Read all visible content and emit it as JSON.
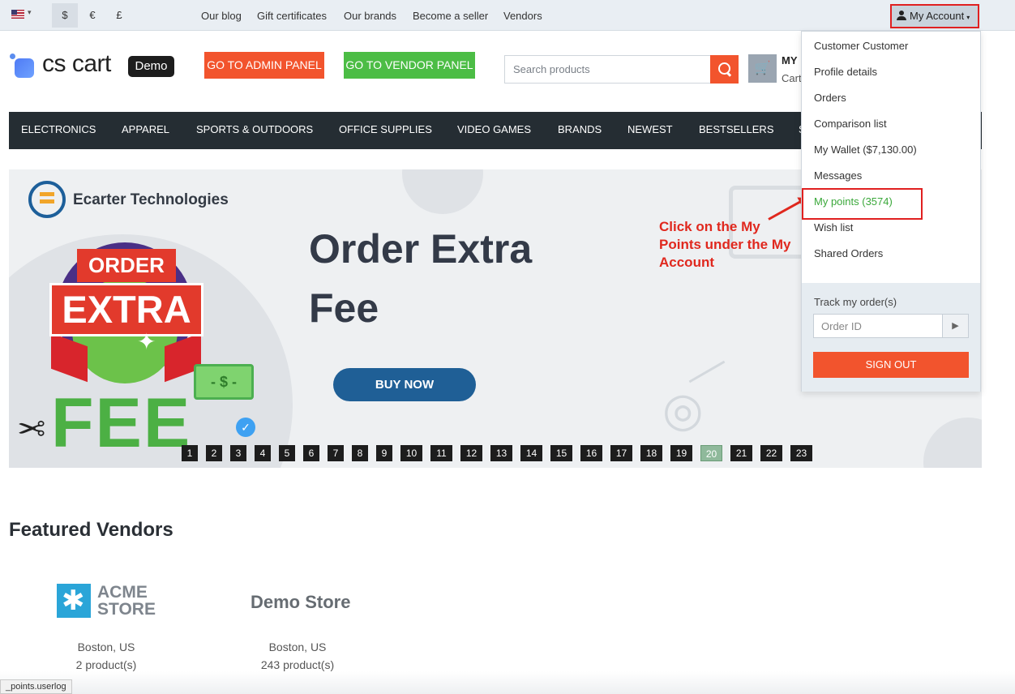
{
  "topbar": {
    "currencies": [
      "$",
      "€",
      "£"
    ],
    "links": [
      "Our blog",
      "Gift certificates",
      "Our brands",
      "Become a seller",
      "Vendors"
    ],
    "account_label": "My Account"
  },
  "header": {
    "logo_text": "cs cart",
    "logo_badge": "Demo",
    "admin_button": "GO TO ADMIN PANEL",
    "vendor_button": "GO TO VENDOR PANEL",
    "search_placeholder": "Search products",
    "cart_title": "MY",
    "cart_sub": "Cart"
  },
  "nav": {
    "items": [
      "ELECTRONICS",
      "APPAREL",
      "SPORTS & OUTDOORS",
      "OFFICE SUPPLIES",
      "VIDEO GAMES",
      "BRANDS",
      "NEWEST",
      "BESTSELLERS",
      "S"
    ]
  },
  "banner": {
    "company": "Ecarter Technologies",
    "badge_order": "ORDER",
    "badge_extra": "EXTRA",
    "badge_fee": "FEE",
    "cash_symbol": "- $ -",
    "headline": "Order Extra Fee",
    "cta": "BUY NOW",
    "annotation_lines": [
      "Click on the My",
      "Points under the My",
      "Account"
    ],
    "pages": [
      "1",
      "2",
      "3",
      "4",
      "5",
      "6",
      "7",
      "8",
      "9",
      "10",
      "11",
      "12",
      "13",
      "14",
      "15",
      "16",
      "17",
      "18",
      "19",
      "20",
      "21",
      "22",
      "23"
    ],
    "active_page": "20"
  },
  "account_menu": {
    "items": [
      "Customer Customer",
      "Profile details",
      "Orders",
      "Comparison list",
      "My Wallet ($7,130.00)",
      "Messages",
      "My points (3574)",
      "Wish list",
      "Shared Orders"
    ],
    "track_label": "Track my order(s)",
    "order_placeholder": "Order ID",
    "sign_out": "SIGN OUT"
  },
  "featured": {
    "title": "Featured Vendors",
    "vendors": [
      {
        "name_line1": "ACME",
        "name_line2": "STORE",
        "location": "Boston, US",
        "products": "2 product(s)"
      },
      {
        "name": "Demo Store",
        "location": "Boston, US",
        "products": "243 product(s)"
      }
    ]
  },
  "status_url": "_points.userlog",
  "colors": {
    "accent": "#f2542d",
    "vendor_green": "#4cbd45",
    "nav_bg": "#252d33",
    "highlight_red": "#e02020",
    "points_green": "#3aa83a"
  }
}
